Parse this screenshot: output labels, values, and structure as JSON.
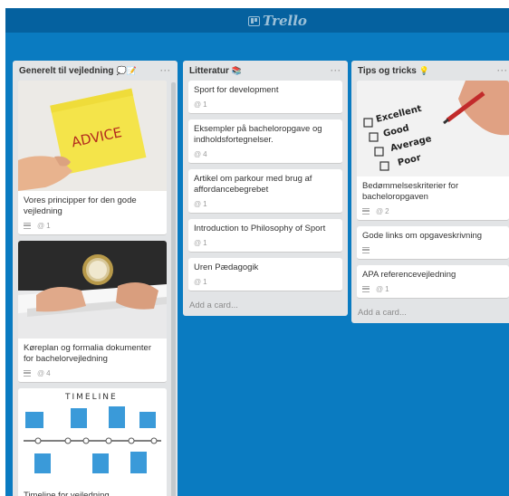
{
  "app": {
    "logo_text": "Trello"
  },
  "lists": [
    {
      "title": "Generelt til vejledning",
      "emoji": "💭📝",
      "cards": [
        {
          "title": "Vores principper for den gode vejledning",
          "attachments": "1",
          "cover_text": "ADVICE"
        },
        {
          "title": "Køreplan og formalia dokumenter for bachelorvejledning",
          "attachments": "4"
        },
        {
          "title": "Timeline for vejledning",
          "cover_text": "TIMELINE"
        }
      ]
    },
    {
      "title": "Litteratur",
      "emoji": "📚",
      "cards": [
        {
          "title": "Sport for development",
          "attachments": "1"
        },
        {
          "title": "Eksempler på bacheloropgave og indholdsfortegnelser.",
          "attachments": "4"
        },
        {
          "title": "Artikel om parkour med brug af affordancebegrebet",
          "attachments": "1"
        },
        {
          "title": "Introduction to Philosophy of Sport",
          "attachments": "1"
        },
        {
          "title": "Uren Pædagogik",
          "attachments": "1"
        }
      ],
      "add_card": "Add a card..."
    },
    {
      "title": "Tips og tricks",
      "emoji": "💡",
      "cards": [
        {
          "title": "Bedømmelseskriterier for bacheloropgaven",
          "attachments": "2",
          "cover_labels": [
            "Excellent",
            "Good",
            "Average",
            "Poor"
          ]
        },
        {
          "title": "Gode links om opgaveskrivning"
        },
        {
          "title": "APA referencevejledning",
          "attachments": "1"
        }
      ],
      "add_card": "Add a card..."
    }
  ],
  "list_menu_label": "···",
  "colors": {
    "board": "#0a7bc1",
    "header": "#05619f",
    "list": "#e2e4e6"
  }
}
